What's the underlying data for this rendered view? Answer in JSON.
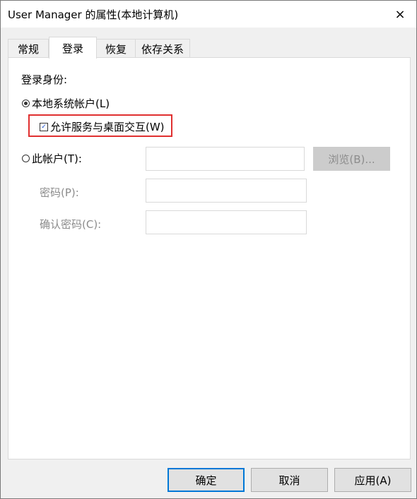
{
  "window": {
    "title": "User Manager 的属性(本地计算机)",
    "close_icon": "×"
  },
  "tabs": [
    {
      "label": "常规",
      "active": false
    },
    {
      "label": "登录",
      "active": true
    },
    {
      "label": "恢复",
      "active": false
    },
    {
      "label": "依存关系",
      "active": false
    }
  ],
  "logon": {
    "section_label": "登录身份:",
    "local_system_label": "本地系统帐户(L)",
    "local_system_selected": true,
    "interact_desktop_label": "允许服务与桌面交互(W)",
    "interact_desktop_checked": true,
    "this_account_label": "此帐户(T):",
    "this_account_selected": false,
    "account_value": "",
    "browse_label": "浏览(B)...",
    "password_label": "密码(P):",
    "password_value": "",
    "confirm_password_label": "确认密码(C):",
    "confirm_password_value": ""
  },
  "footer": {
    "ok_label": "确定",
    "cancel_label": "取消",
    "apply_label": "应用(A)"
  },
  "colors": {
    "highlight": "#e03030",
    "default_button_border": "#0078d7",
    "disabled_text": "#8c8c8c"
  }
}
